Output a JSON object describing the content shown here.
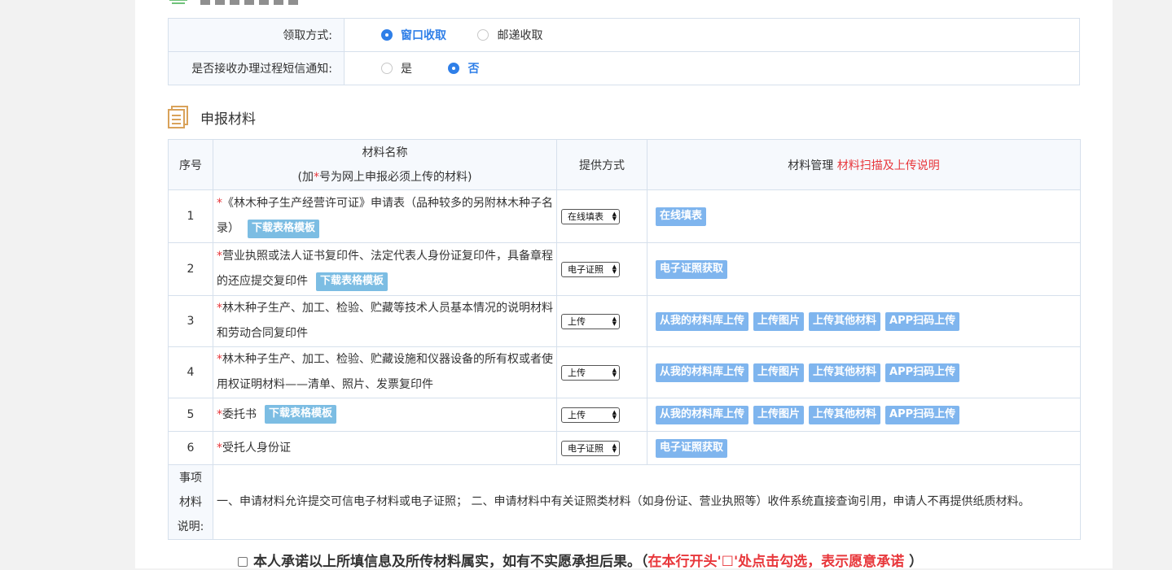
{
  "delivery": {
    "label": "领取方式:",
    "options": [
      {
        "label": "窗口收取",
        "selected": true
      },
      {
        "label": "邮递收取",
        "selected": false
      }
    ]
  },
  "sms": {
    "label": "是否接收办理过程短信通知:",
    "options": [
      {
        "label": "是",
        "selected": false
      },
      {
        "label": "否",
        "selected": true
      }
    ]
  },
  "materials_section": {
    "title": "申报材料"
  },
  "table": {
    "headers": {
      "no": "序号",
      "name_line1": "材料名称",
      "name_line2_a": "(加",
      "name_line2_star": "*",
      "name_line2_b": "号为网上申报必须上传的材料)",
      "way": "提供方式",
      "manage": "材料管理",
      "manage_link": "材料扫描及上传说明"
    },
    "rows": [
      {
        "no": "1",
        "star": "*",
        "name": "《林木种子生产经营许可证》申请表（品种较多的另附林木种子名录）",
        "download": "下载表格模板",
        "way": "在线填表",
        "actions": [
          "在线填表"
        ]
      },
      {
        "no": "2",
        "star": "*",
        "name": "营业执照或法人证书复印件、法定代表人身份证复印件，具备章程的还应提交复印件",
        "download": "下载表格模板",
        "way": "电子证照",
        "actions": [
          "电子证照获取"
        ]
      },
      {
        "no": "3",
        "star": "*",
        "name": "林木种子生产、加工、检验、贮藏等技术人员基本情况的说明材料和劳动合同复印件",
        "download": "",
        "way": "上传",
        "actions": [
          "从我的材料库上传",
          "上传图片",
          "上传其他材料",
          "APP扫码上传"
        ]
      },
      {
        "no": "4",
        "star": "*",
        "name": "林木种子生产、加工、检验、贮藏设施和仪器设备的所有权或者使用权证明材料——清单、照片、发票复印件",
        "download": "",
        "way": "上传",
        "actions": [
          "从我的材料库上传",
          "上传图片",
          "上传其他材料",
          "APP扫码上传"
        ]
      },
      {
        "no": "5",
        "star": "*",
        "name": "委托书",
        "download": "下载表格模板",
        "way": "上传",
        "actions": [
          "从我的材料库上传",
          "上传图片",
          "上传其他材料",
          "APP扫码上传"
        ]
      },
      {
        "no": "6",
        "star": "*",
        "name": "受托人身份证",
        "download": "",
        "way": "电子证照",
        "actions": [
          "电子证照获取"
        ]
      }
    ],
    "note": {
      "label_lines": [
        "事项",
        "材料",
        "说明:"
      ],
      "text": "一、申请材料允许提交可信电子材料或电子证照； 二、申请材料中有关证照类材料（如身份证、营业执照等）收件系统直接查询引用，申请人不再提供纸质材料。"
    }
  },
  "promise": {
    "text": "本人承诺以上所填信息及所传材料属实，如有不实愿承担后果。（",
    "hint": "在本行开头'☐'处点击勾选，表示愿意承诺",
    "close": "）"
  },
  "colors": {
    "accent": "#2f7fe8",
    "required": "#e8373b",
    "button": "#7fb5ee",
    "border": "#d6e0ec"
  }
}
